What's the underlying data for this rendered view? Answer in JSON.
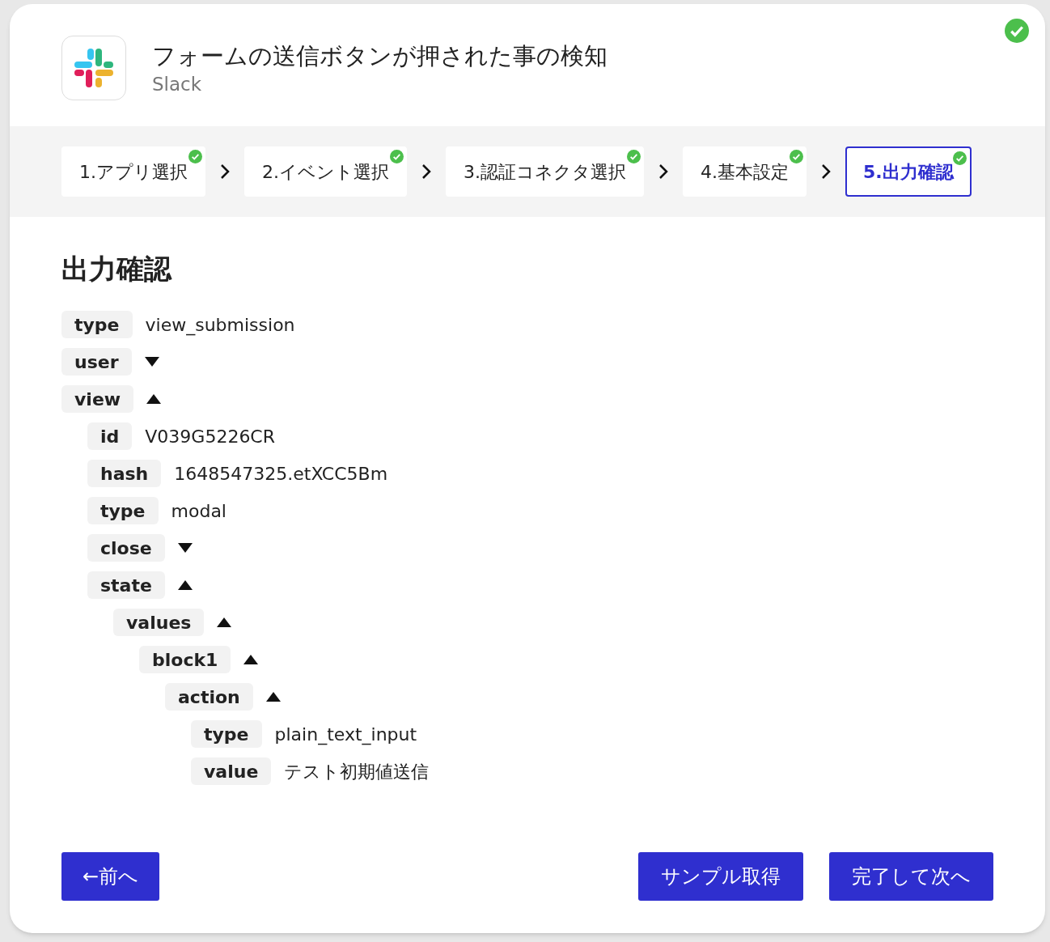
{
  "header": {
    "title": "フォームの送信ボタンが押された事の検知",
    "app_name": "Slack",
    "completed": true
  },
  "steps": [
    {
      "label": "1.アプリ選択",
      "done": true,
      "selected": false
    },
    {
      "label": "2.イベント選択",
      "done": true,
      "selected": false
    },
    {
      "label": "3.認証コネクタ選択",
      "done": true,
      "selected": false
    },
    {
      "label": "4.基本設定",
      "done": true,
      "selected": false
    },
    {
      "label": "5.出力確認",
      "done": true,
      "selected": true
    }
  ],
  "section_title": "出力確認",
  "tree": [
    {
      "key": "type",
      "value": "view_submission"
    },
    {
      "key": "user",
      "expanded": false
    },
    {
      "key": "view",
      "expanded": true,
      "children": [
        {
          "key": "id",
          "value": "V039G5226CR"
        },
        {
          "key": "hash",
          "value": "1648547325.etXCC5Bm"
        },
        {
          "key": "type",
          "value": "modal"
        },
        {
          "key": "close",
          "expanded": false
        },
        {
          "key": "state",
          "expanded": true,
          "children": [
            {
              "key": "values",
              "expanded": true,
              "children": [
                {
                  "key": "block1",
                  "expanded": true,
                  "children": [
                    {
                      "key": "action",
                      "expanded": true,
                      "children": [
                        {
                          "key": "type",
                          "value": "plain_text_input"
                        },
                        {
                          "key": "value",
                          "value": "テスト初期値送信"
                        }
                      ]
                    }
                  ]
                }
              ]
            }
          ]
        }
      ]
    }
  ],
  "buttons": {
    "back": "←前へ",
    "sample": "サンプル取得",
    "next": "完了して次へ"
  }
}
